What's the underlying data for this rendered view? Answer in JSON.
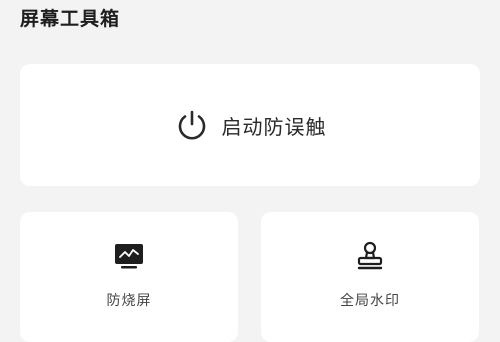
{
  "header": {
    "title": "屏幕工具箱"
  },
  "main_action": {
    "label": "启动防误触",
    "icon": "power-icon"
  },
  "tools": [
    {
      "label": "防烧屏",
      "icon": "monitor-chart-icon"
    },
    {
      "label": "全局水印",
      "icon": "stamp-icon"
    }
  ]
}
